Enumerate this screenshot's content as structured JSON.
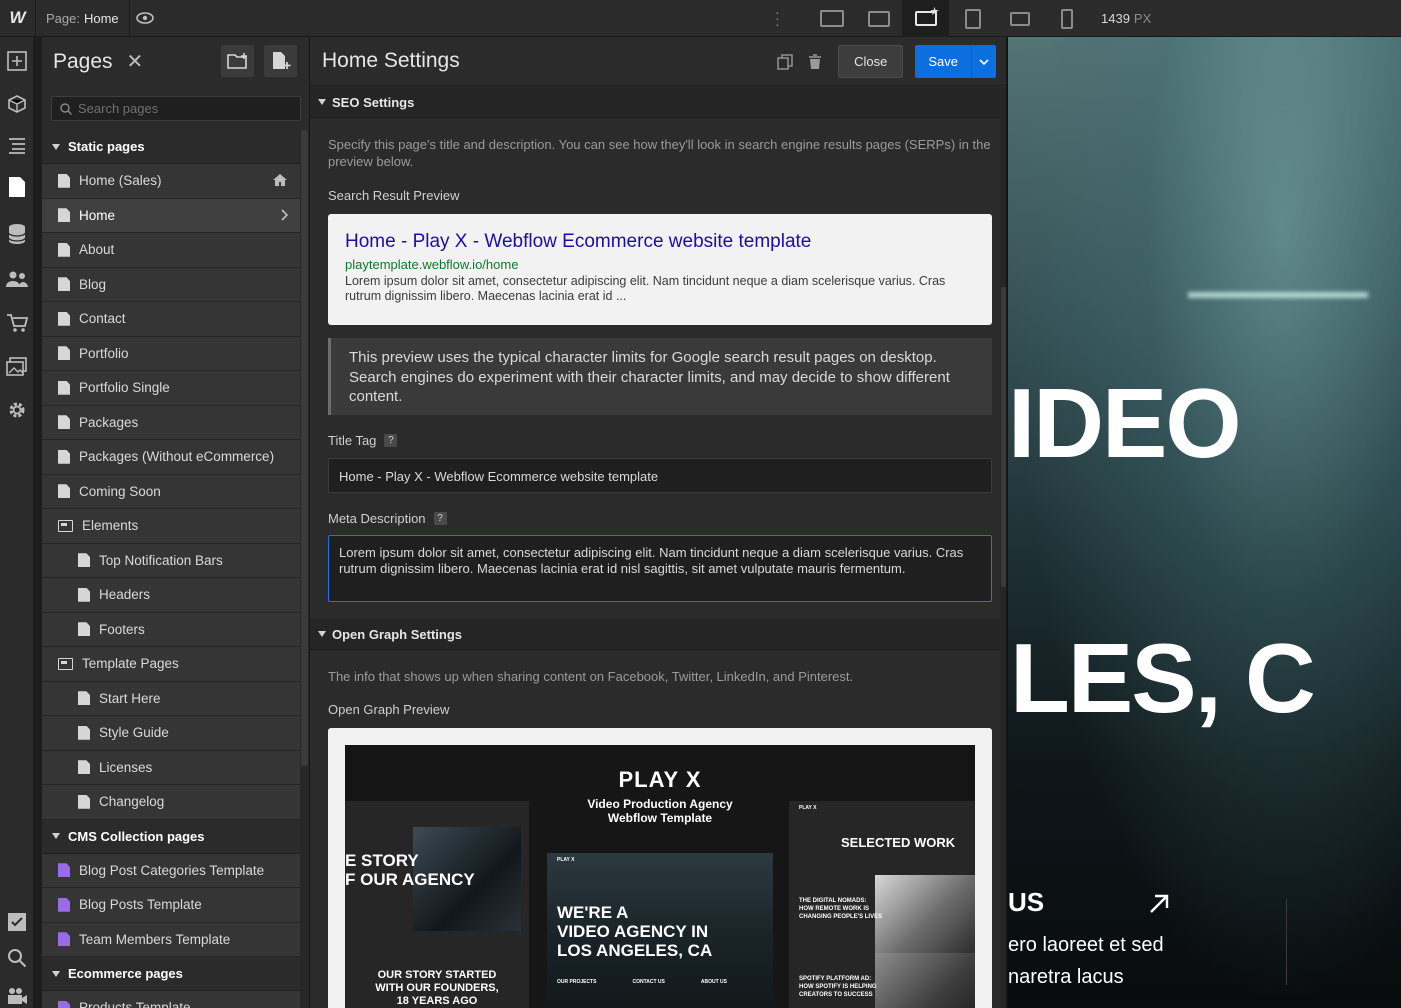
{
  "topbar": {
    "page_prefix": "Page:",
    "page_name": "Home",
    "canvas_width": "1439",
    "canvas_unit": "PX",
    "devices": [
      "desktop-large-icon",
      "desktop-icon",
      "desktop-base-icon",
      "tablet-icon",
      "mobile-landscape-icon",
      "mobile-portrait-icon"
    ]
  },
  "pages_panel": {
    "title": "Pages",
    "search_placeholder": "Search pages",
    "groups": [
      {
        "label": "Static pages",
        "items": [
          {
            "label": "Home (Sales)",
            "level": 1,
            "type": "page",
            "badge": "home-icon"
          },
          {
            "label": "Home",
            "level": 1,
            "type": "page",
            "selected": true,
            "badge": "chevron-right-icon"
          },
          {
            "label": "About",
            "level": 1,
            "type": "page"
          },
          {
            "label": "Blog",
            "level": 1,
            "type": "page"
          },
          {
            "label": "Contact",
            "level": 1,
            "type": "page"
          },
          {
            "label": "Portfolio",
            "level": 1,
            "type": "page"
          },
          {
            "label": "Portfolio Single",
            "level": 1,
            "type": "page"
          },
          {
            "label": "Packages",
            "level": 1,
            "type": "page"
          },
          {
            "label": "Packages (Without eCommerce)",
            "level": 1,
            "type": "page"
          },
          {
            "label": "Coming Soon",
            "level": 1,
            "type": "page"
          },
          {
            "label": "Elements",
            "level": 1,
            "type": "folder"
          },
          {
            "label": "Top Notification Bars",
            "level": 2,
            "type": "page"
          },
          {
            "label": "Headers",
            "level": 2,
            "type": "page"
          },
          {
            "label": "Footers",
            "level": 2,
            "type": "page"
          },
          {
            "label": "Template Pages",
            "level": 1,
            "type": "folder"
          },
          {
            "label": "Start Here",
            "level": 2,
            "type": "page"
          },
          {
            "label": "Style Guide",
            "level": 2,
            "type": "page"
          },
          {
            "label": "Licenses",
            "level": 2,
            "type": "page"
          },
          {
            "label": "Changelog",
            "level": 2,
            "type": "page"
          }
        ]
      },
      {
        "label": "CMS Collection pages",
        "items": [
          {
            "label": "Blog Post Categories Template",
            "level": 1,
            "type": "cms"
          },
          {
            "label": "Blog Posts Template",
            "level": 1,
            "type": "cms"
          },
          {
            "label": "Team Members Template",
            "level": 1,
            "type": "cms"
          }
        ]
      },
      {
        "label": "Ecommerce pages",
        "items": [
          {
            "label": "Products Template",
            "level": 1,
            "type": "cms"
          }
        ]
      }
    ]
  },
  "settings": {
    "title": "Home Settings",
    "close_label": "Close",
    "save_label": "Save",
    "seo": {
      "heading": "SEO Settings",
      "intro": "Specify this page's title and description. You can see how they'll look in search engine results pages (SERPs) in the preview below.",
      "preview_label": "Search Result Preview",
      "serp_title": "Home - Play X - Webflow Ecommerce website template",
      "serp_url": "playtemplate.webflow.io/home",
      "serp_desc": "Lorem ipsum dolor sit amet, consectetur adipiscing elit. Nam tincidunt neque a diam scelerisque varius. Cras rutrum dignissim libero. Maecenas lacinia erat id ...",
      "note": "This preview uses the typical character limits for Google search result pages on desktop. Search engines do experiment with their character limits, and may decide to show different content.",
      "title_tag_label": "Title Tag",
      "title_tag_value": "Home - Play X - Webflow Ecommerce website template",
      "meta_label": "Meta Description",
      "meta_value": "Lorem ipsum dolor sit amet, consectetur adipiscing elit. Nam tincidunt neque a diam scelerisque varius. Cras rutrum dignissim libero. Maecenas lacinia erat id nisl sagittis, sit amet vulputate mauris fermentum.",
      "help": "?"
    },
    "og": {
      "heading": "Open Graph Settings",
      "intro": "The info that shows up when sharing content on Facebook, Twitter, LinkedIn, and Pinterest.",
      "preview_label": "Open Graph Preview",
      "image": {
        "brand": "PLAY X",
        "subtitle_1": "Video Production Agency",
        "subtitle_2": "Webflow Template",
        "left_heading_1": "E STORY",
        "left_heading_2": "F OUR AGENCY",
        "left_footer_1": "OUR STORY STARTED",
        "left_footer_2": "WITH OUR FOUNDERS,",
        "left_footer_3": "18 YEARS AGO",
        "center_small": "PLAY X",
        "center_heading_1": "WE'RE A",
        "center_heading_2": "VIDEO AGENCY IN",
        "center_heading_3": "LOS ANGELES, CA",
        "center_links": [
          "OUR PROJECTS",
          "CONTACT US",
          "ABOUT US"
        ],
        "right_small": "PLAY X",
        "right_heading": "SELECTED WORK",
        "right_item_1a": "THE DIGITAL NOMADS:",
        "right_item_1b": "HOW REMOTE WORK IS",
        "right_item_1c": "CHANGING PEOPLE'S LIVES",
        "right_item_2a": "SPOTIFY PLATFORM AD:",
        "right_item_2b": "HOW SPOTIFY IS HELPING",
        "right_item_2c": "CREATORS TO SUCCESS"
      }
    }
  },
  "canvas": {
    "big_1": "IDEO",
    "big_2": "LES, C",
    "label_us": "US",
    "line_1": "ero laoreet et sed",
    "line_2": "naretra lacus"
  }
}
